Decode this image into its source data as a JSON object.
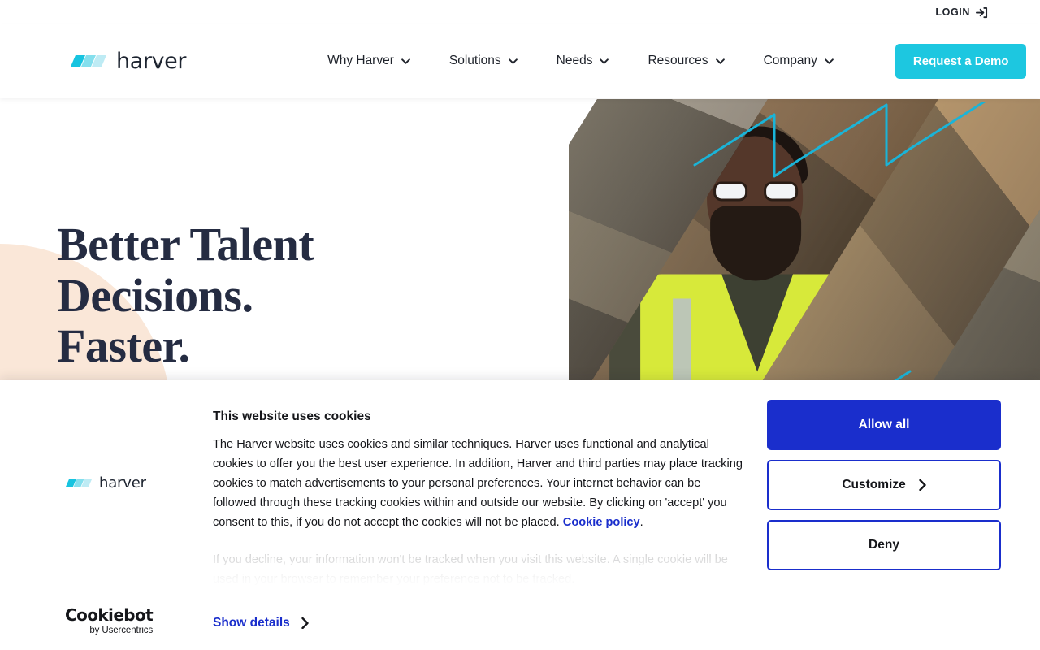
{
  "utility": {
    "login_label": "LOGIN",
    "login_icon": "sign-in-icon"
  },
  "header": {
    "logo_word": "harver",
    "logo_icon": "harver-logo-mark",
    "nav": [
      {
        "label": "Why Harver",
        "icon": "chevron-down-icon"
      },
      {
        "label": "Solutions",
        "icon": "chevron-down-icon"
      },
      {
        "label": "Needs",
        "icon": "chevron-down-icon"
      },
      {
        "label": "Resources",
        "icon": "chevron-down-icon"
      },
      {
        "label": "Company",
        "icon": "chevron-down-icon"
      }
    ],
    "cta_label": "Request a Demo"
  },
  "hero": {
    "line1": "Better Talent",
    "line2": "Decisions.",
    "line3": "Faster.",
    "image_alt": "warehouse-worker-with-tablet"
  },
  "cookie_banner": {
    "brand_word": "harver",
    "brand_icon": "harver-logo-mark",
    "provider_name": "Cookiebot",
    "provider_sub": "by Usercentrics",
    "title": "This website uses cookies",
    "body_text": "The Harver website uses cookies and similar techniques. Harver uses functional and analytical cookies to offer you the best user experience. In addition, Harver and third parties may place tracking cookies to match advertisements to your personal preferences. Your internet behavior can be followed through these tracking cookies within and outside our website. By clicking on 'accept' you consent to this, if you do not accept the cookies will not be placed. ",
    "policy_link_label": "Cookie policy",
    "body_text_end": ".",
    "body_text_2": "If you decline, your information won't be tracked when you visit this website. A single cookie will be used in your browser to remember your preference not to be tracked.",
    "show_details_label": "Show details",
    "show_details_icon": "chevron-right-icon",
    "buttons": {
      "allow_all": "Allow all",
      "customize": "Customize",
      "customize_icon": "chevron-right-icon",
      "deny": "Deny"
    }
  },
  "colors": {
    "brand_cyan": "#1dc7e0",
    "cta_blue": "#1a2ecc",
    "heading_navy": "#252c42",
    "blob_peach": "#fae7d8",
    "line_cyan": "#1ab4d8"
  }
}
